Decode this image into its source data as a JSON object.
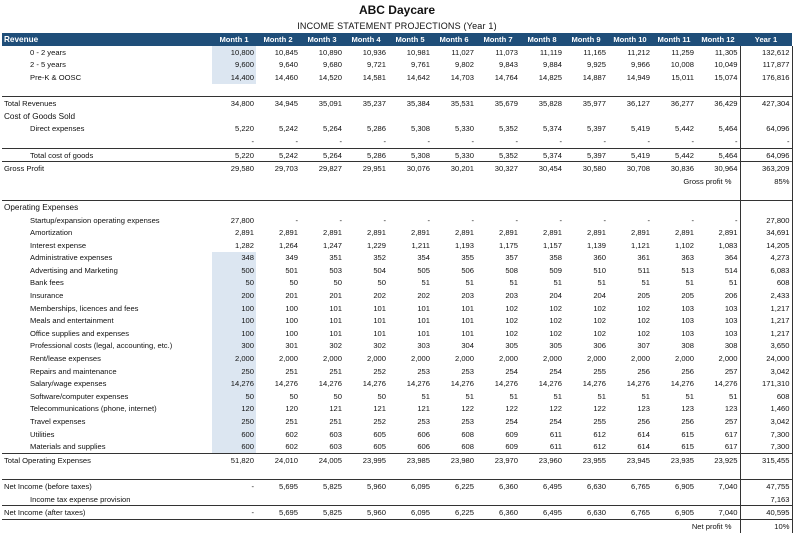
{
  "title": "ABC Daycare",
  "subtitle": "INCOME STATEMENT PROJECTIONS (Year 1)",
  "header": {
    "label": "Revenue",
    "months": [
      "Month 1",
      "Month 2",
      "Month 3",
      "Month 4",
      "Month 5",
      "Month 6",
      "Month 7",
      "Month 8",
      "Month 9",
      "Month 10",
      "Month 11",
      "Month 12"
    ],
    "year": "Year 1"
  },
  "rows": [
    {
      "label": "0 - 2 years",
      "vals": [
        "10,800",
        "10,845",
        "10,890",
        "10,936",
        "10,981",
        "11,027",
        "11,073",
        "11,119",
        "11,165",
        "11,212",
        "11,259",
        "11,305"
      ],
      "year": "132,612",
      "indent": true,
      "input": true
    },
    {
      "label": "2 - 5 years",
      "vals": [
        "9,600",
        "9,640",
        "9,680",
        "9,721",
        "9,761",
        "9,802",
        "9,843",
        "9,884",
        "9,925",
        "9,966",
        "10,008",
        "10,049"
      ],
      "year": "117,877",
      "indent": true,
      "input": true
    },
    {
      "label": "Pre-K & OOSC",
      "vals": [
        "14,400",
        "14,460",
        "14,520",
        "14,581",
        "14,642",
        "14,703",
        "14,764",
        "14,825",
        "14,887",
        "14,949",
        "15,011",
        "15,074"
      ],
      "year": "176,816",
      "indent": true,
      "input": true
    },
    {
      "label": "",
      "vals": [
        "",
        "",
        "",
        "",
        "",
        "",
        "",
        "",
        "",
        "",
        "",
        ""
      ],
      "year": ""
    },
    {
      "label": "Total Revenues",
      "vals": [
        "34,800",
        "34,945",
        "35,091",
        "35,237",
        "35,384",
        "35,531",
        "35,679",
        "35,828",
        "35,977",
        "36,127",
        "36,277",
        "36,429"
      ],
      "year": "427,304",
      "style": "bt"
    },
    {
      "label": "Cost of Goods Sold",
      "vals": [
        "",
        "",
        "",
        "",
        "",
        "",
        "",
        "",
        "",
        "",
        "",
        ""
      ],
      "year": "",
      "section": true
    },
    {
      "label": "Direct expenses",
      "vals": [
        "5,220",
        "5,242",
        "5,264",
        "5,286",
        "5,308",
        "5,330",
        "5,352",
        "5,374",
        "5,397",
        "5,419",
        "5,442",
        "5,464"
      ],
      "year": "64,096",
      "indent": true
    },
    {
      "label": "",
      "vals": [
        "-",
        "-",
        "-",
        "-",
        "-",
        "-",
        "-",
        "-",
        "-",
        "-",
        "-",
        "-"
      ],
      "year": "-"
    },
    {
      "label": "Total cost of goods",
      "vals": [
        "5,220",
        "5,242",
        "5,264",
        "5,286",
        "5,308",
        "5,330",
        "5,352",
        "5,374",
        "5,397",
        "5,419",
        "5,442",
        "5,464"
      ],
      "year": "64,096",
      "indent": true,
      "style": "bt"
    },
    {
      "label": "Gross Profit",
      "vals": [
        "29,580",
        "29,703",
        "29,827",
        "29,951",
        "30,076",
        "30,201",
        "30,327",
        "30,454",
        "30,580",
        "30,708",
        "30,836",
        "30,964"
      ],
      "year": "363,209",
      "style": "bt"
    },
    {
      "label": "",
      "vals": [
        "",
        "",
        "",
        "",
        "",
        "",
        "",
        "",
        "",
        "",
        "",
        ""
      ],
      "year": "85%",
      "note": "Gross profit %"
    },
    {
      "label": "",
      "vals": [
        "",
        "",
        "",
        "",
        "",
        "",
        "",
        "",
        "",
        "",
        "",
        ""
      ],
      "year": ""
    },
    {
      "label": "Operating Expenses",
      "vals": [
        "",
        "",
        "",
        "",
        "",
        "",
        "",
        "",
        "",
        "",
        "",
        ""
      ],
      "year": "",
      "section": true,
      "style": "bt"
    },
    {
      "label": "Startup/expansion operating expenses",
      "vals": [
        "27,800",
        "-",
        "-",
        "-",
        "-",
        "-",
        "-",
        "-",
        "-",
        "-",
        "-",
        "-"
      ],
      "year": "27,800",
      "indent": true
    },
    {
      "label": "Amortization",
      "vals": [
        "2,891",
        "2,891",
        "2,891",
        "2,891",
        "2,891",
        "2,891",
        "2,891",
        "2,891",
        "2,891",
        "2,891",
        "2,891",
        "2,891"
      ],
      "year": "34,691",
      "indent": true
    },
    {
      "label": "Interest expense",
      "vals": [
        "1,282",
        "1,264",
        "1,247",
        "1,229",
        "1,211",
        "1,193",
        "1,175",
        "1,157",
        "1,139",
        "1,121",
        "1,102",
        "1,083"
      ],
      "year": "14,205",
      "indent": true
    },
    {
      "label": "Administrative expenses",
      "vals": [
        "348",
        "349",
        "351",
        "352",
        "354",
        "355",
        "357",
        "358",
        "360",
        "361",
        "363",
        "364"
      ],
      "year": "4,273",
      "indent": true,
      "input": true
    },
    {
      "label": "Advertising and Marketing",
      "vals": [
        "500",
        "501",
        "503",
        "504",
        "505",
        "506",
        "508",
        "509",
        "510",
        "511",
        "513",
        "514"
      ],
      "year": "6,083",
      "indent": true,
      "input": true
    },
    {
      "label": "Bank fees",
      "vals": [
        "50",
        "50",
        "50",
        "50",
        "51",
        "51",
        "51",
        "51",
        "51",
        "51",
        "51",
        "51"
      ],
      "year": "608",
      "indent": true,
      "input": true
    },
    {
      "label": "Insurance",
      "vals": [
        "200",
        "201",
        "201",
        "202",
        "202",
        "203",
        "203",
        "204",
        "204",
        "205",
        "205",
        "206"
      ],
      "year": "2,433",
      "indent": true,
      "input": true
    },
    {
      "label": "Memberships, licences and fees",
      "vals": [
        "100",
        "100",
        "101",
        "101",
        "101",
        "101",
        "102",
        "102",
        "102",
        "102",
        "103",
        "103"
      ],
      "year": "1,217",
      "indent": true,
      "input": true
    },
    {
      "label": "Meals and entertainment",
      "vals": [
        "100",
        "100",
        "101",
        "101",
        "101",
        "101",
        "102",
        "102",
        "102",
        "102",
        "103",
        "103"
      ],
      "year": "1,217",
      "indent": true,
      "input": true
    },
    {
      "label": "Office supplies and expenses",
      "vals": [
        "100",
        "100",
        "101",
        "101",
        "101",
        "101",
        "102",
        "102",
        "102",
        "102",
        "103",
        "103"
      ],
      "year": "1,217",
      "indent": true,
      "input": true
    },
    {
      "label": "Professional costs (legal, accounting, etc.)",
      "vals": [
        "300",
        "301",
        "302",
        "302",
        "303",
        "304",
        "305",
        "305",
        "306",
        "307",
        "308",
        "308"
      ],
      "year": "3,650",
      "indent": true,
      "input": true
    },
    {
      "label": "Rent/lease expenses",
      "vals": [
        "2,000",
        "2,000",
        "2,000",
        "2,000",
        "2,000",
        "2,000",
        "2,000",
        "2,000",
        "2,000",
        "2,000",
        "2,000",
        "2,000"
      ],
      "year": "24,000",
      "indent": true,
      "input": true
    },
    {
      "label": "Repairs and maintenance",
      "vals": [
        "250",
        "251",
        "251",
        "252",
        "253",
        "253",
        "254",
        "254",
        "255",
        "256",
        "256",
        "257"
      ],
      "year": "3,042",
      "indent": true,
      "input": true
    },
    {
      "label": "Salary/wage expenses",
      "vals": [
        "14,276",
        "14,276",
        "14,276",
        "14,276",
        "14,276",
        "14,276",
        "14,276",
        "14,276",
        "14,276",
        "14,276",
        "14,276",
        "14,276"
      ],
      "year": "171,310",
      "indent": true,
      "input": true
    },
    {
      "label": "Software/computer expenses",
      "vals": [
        "50",
        "50",
        "50",
        "50",
        "51",
        "51",
        "51",
        "51",
        "51",
        "51",
        "51",
        "51"
      ],
      "year": "608",
      "indent": true,
      "input": true
    },
    {
      "label": "Telecommunications (phone, internet)",
      "vals": [
        "120",
        "120",
        "121",
        "121",
        "121",
        "122",
        "122",
        "122",
        "122",
        "123",
        "123",
        "123"
      ],
      "year": "1,460",
      "indent": true,
      "input": true
    },
    {
      "label": "Travel expenses",
      "vals": [
        "250",
        "251",
        "251",
        "252",
        "253",
        "253",
        "254",
        "254",
        "255",
        "256",
        "256",
        "257"
      ],
      "year": "3,042",
      "indent": true,
      "input": true
    },
    {
      "label": "Utilities",
      "vals": [
        "600",
        "602",
        "603",
        "605",
        "606",
        "608",
        "609",
        "611",
        "612",
        "614",
        "615",
        "617"
      ],
      "year": "7,300",
      "indent": true,
      "input": true
    },
    {
      "label": "Materials and supplies",
      "vals": [
        "600",
        "602",
        "603",
        "605",
        "606",
        "608",
        "609",
        "611",
        "612",
        "614",
        "615",
        "617"
      ],
      "year": "7,300",
      "indent": true,
      "input": true
    },
    {
      "label": "Total Operating Expenses",
      "vals": [
        "51,820",
        "24,010",
        "24,005",
        "23,995",
        "23,985",
        "23,980",
        "23,970",
        "23,960",
        "23,955",
        "23,945",
        "23,935",
        "23,925"
      ],
      "year": "315,455",
      "style": "bt"
    },
    {
      "label": "",
      "vals": [
        "",
        "",
        "",
        "",
        "",
        "",
        "",
        "",
        "",
        "",
        "",
        ""
      ],
      "year": ""
    },
    {
      "label": "Net Income (before taxes)",
      "vals": [
        "-",
        "5,695",
        "5,825",
        "5,960",
        "6,095",
        "6,225",
        "6,360",
        "6,495",
        "6,630",
        "6,765",
        "6,905",
        "7,040"
      ],
      "year": "47,755",
      "style": "bt"
    },
    {
      "label": "Income tax expense provision",
      "vals": [
        "",
        "",
        "",
        "",
        "",
        "",
        "",
        "",
        "",
        "",
        "",
        ""
      ],
      "year": "7,163",
      "indent": true
    },
    {
      "label": "Net Income (after taxes)",
      "vals": [
        "-",
        "5,695",
        "5,825",
        "5,960",
        "6,095",
        "6,225",
        "6,360",
        "6,495",
        "6,630",
        "6,765",
        "6,905",
        "7,040"
      ],
      "year": "40,595",
      "style": "bt bb"
    },
    {
      "label": "",
      "vals": [
        "",
        "",
        "",
        "",
        "",
        "",
        "",
        "",
        "",
        "",
        "",
        ""
      ],
      "year": "10%",
      "note": "Net profit %"
    }
  ]
}
